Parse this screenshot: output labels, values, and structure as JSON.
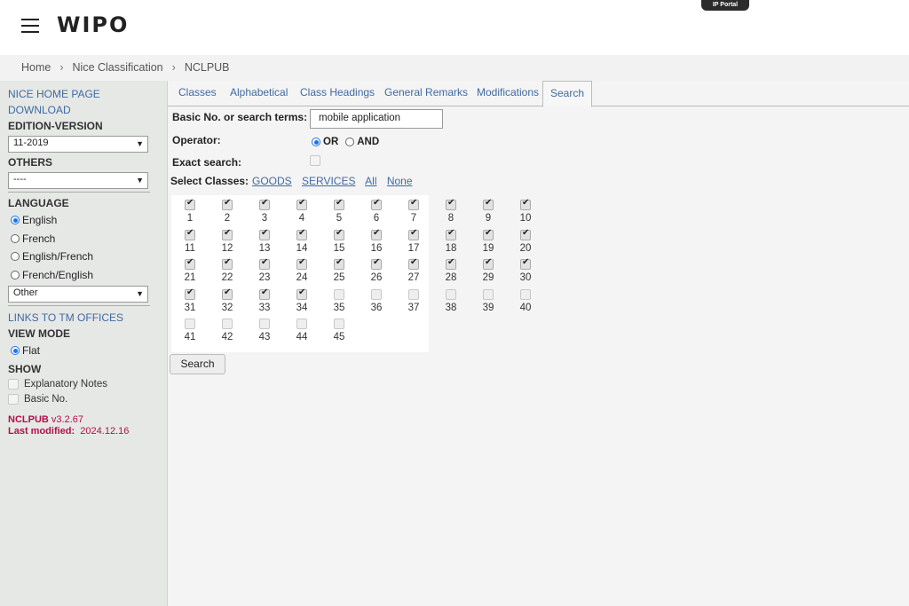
{
  "header": {
    "logo": "WIPO",
    "ip_portal": "IP Portal"
  },
  "breadcrumb": {
    "items": [
      "Home",
      "Nice Classification",
      "NCLPUB"
    ],
    "separator": "›"
  },
  "sidebar": {
    "nice_home": "NICE HOME PAGE",
    "download": "DOWNLOAD",
    "edition_label": "EDITION-VERSION",
    "edition_value": "11-2019",
    "others_label": "OTHERS",
    "others_value": "----",
    "language_label": "LANGUAGE",
    "languages": [
      "English",
      "French",
      "English/French",
      "French/English"
    ],
    "language_selected": "English",
    "language_other": "Other",
    "links_tm": "LINKS TO TM OFFICES",
    "view_mode_label": "VIEW MODE",
    "view_mode_value": "Flat",
    "show_label": "SHOW",
    "show_options": [
      "Explanatory Notes",
      "Basic No."
    ],
    "version_name": "NCLPUB",
    "version_value": "v3.2.67",
    "last_modified_label": "Last modified:",
    "last_modified_value": "2024.12.16"
  },
  "tabs": [
    "Classes",
    "Alphabetical",
    "Class Headings",
    "General Remarks",
    "Modifications",
    "Search"
  ],
  "active_tab": "Search",
  "form": {
    "basic_label": "Basic No. or search terms:",
    "search_value": "mobile application",
    "operator_label": "Operator:",
    "op_or": "OR",
    "op_and": "AND",
    "op_selected": "OR",
    "exact_label": "Exact search:",
    "select_classes_label": "Select Classes:",
    "links": [
      "GOODS",
      "SERVICES",
      "All",
      "None"
    ],
    "search_button": "Search"
  },
  "classes": {
    "checked": [
      1,
      2,
      3,
      4,
      5,
      6,
      7,
      8,
      9,
      10,
      11,
      12,
      13,
      14,
      15,
      16,
      17,
      18,
      19,
      20,
      21,
      22,
      23,
      24,
      25,
      26,
      27,
      28,
      29,
      30,
      31,
      32,
      33,
      34
    ],
    "unchecked": [
      35,
      36,
      37,
      38,
      39,
      40,
      41,
      42,
      43,
      44,
      45
    ]
  },
  "colors": {
    "link": "#3f6aa1",
    "version": "#b0104a",
    "radio": "#1a73e8"
  }
}
